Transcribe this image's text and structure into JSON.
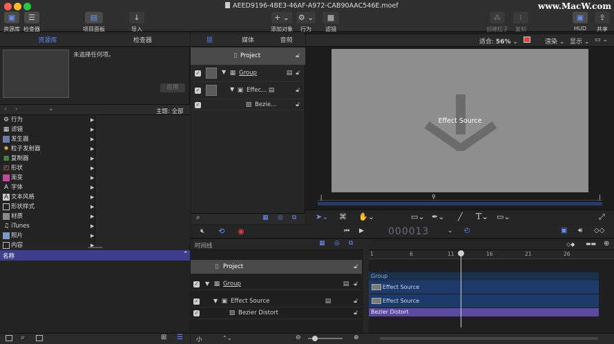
{
  "window": {
    "title": "AEED9196-4BE3-46AF-A972-CAB90AAC546E.moef",
    "watermark": "www.MacW.com"
  },
  "toolbar": {
    "library_label": "资源库",
    "inspector_label": "检查器",
    "project_pane_label": "项目面板",
    "import_label": "导入",
    "add_object_label": "添加对象",
    "behaviors_label": "行为",
    "filters_label": "滤镜",
    "make_particles_label": "创建粒子",
    "replicate_label": "复制",
    "hud_label": "HUD",
    "share_label": "共享"
  },
  "library": {
    "tabs": [
      "资源库",
      "检查器"
    ],
    "preview_text": "未选择任何项。",
    "apply_label": "应用",
    "theme_label": "主题: 全部",
    "categories": [
      {
        "label": "行为",
        "icon": "gear-icon"
      },
      {
        "label": "滤镜",
        "icon": "filter-icon"
      },
      {
        "label": "发生器",
        "icon": "generator-icon"
      },
      {
        "label": "粒子发射器",
        "icon": "particle-icon"
      },
      {
        "label": "复制器",
        "icon": "replicator-icon"
      },
      {
        "label": "形状",
        "icon": "shape-icon"
      },
      {
        "label": "渐变",
        "icon": "gradient-icon"
      },
      {
        "label": "字体",
        "icon": "font-icon"
      },
      {
        "label": "文本风格",
        "icon": "text-style-icon"
      },
      {
        "label": "形状样式",
        "icon": "shape-style-icon"
      },
      {
        "label": "材质",
        "icon": "material-icon"
      },
      {
        "label": "iTunes",
        "icon": "music-icon"
      },
      {
        "label": "照片",
        "icon": "photo-icon"
      },
      {
        "label": "内容",
        "icon": "content-icon"
      }
    ],
    "name_header": "名称"
  },
  "layers": {
    "tabs": [
      "层",
      "媒体",
      "音频"
    ],
    "project_label": "Project",
    "rows": [
      {
        "label": "Group"
      },
      {
        "label": "Effec..."
      },
      {
        "label": "Bezie..."
      }
    ]
  },
  "viewer": {
    "fit_label": "适合:",
    "zoom": "56%",
    "render_label": "渲染",
    "display_label": "显示",
    "canvas_text": "Effect Source"
  },
  "timing": {
    "timecode": "000013",
    "timeline_label": "时间线"
  },
  "timeline": {
    "project_label": "Project",
    "rows": [
      {
        "label": "Group"
      },
      {
        "label": "Effect Source"
      },
      {
        "label": "Bezier Distort"
      }
    ],
    "ruler": [
      "1",
      "6",
      "11",
      "16",
      "21",
      "26"
    ],
    "clips": [
      {
        "label": "Group"
      },
      {
        "label": "Effect Source"
      },
      {
        "label": "Effect Source"
      },
      {
        "label": "Bezier Distort"
      }
    ],
    "size_label": "小"
  }
}
